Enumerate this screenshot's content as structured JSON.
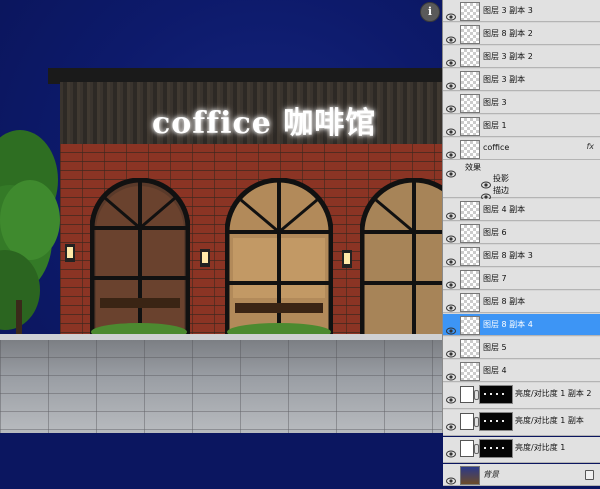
{
  "canvas": {
    "sign_text": "coffice 咖啡馆"
  },
  "panel": {
    "info_icon": "i",
    "layers": [
      {
        "name": "图层 3 副本 3",
        "thumb": "transparent"
      },
      {
        "name": "图层 8 副本 2",
        "thumb": "transparent"
      },
      {
        "name": "图层 3 副本 2",
        "thumb": "transparent"
      },
      {
        "name": "图层 3 副本",
        "thumb": "transparent"
      },
      {
        "name": "图层 3",
        "thumb": "transparent"
      },
      {
        "name": "图层 1",
        "thumb": "transparent"
      },
      {
        "name": "coffice",
        "thumb": "transparent",
        "fx": "fx"
      },
      {
        "name": "图层 4 副本",
        "thumb": "transparent"
      },
      {
        "name": "图层 6",
        "thumb": "transparent"
      },
      {
        "name": "图层 8 副本 3",
        "thumb": "transparent"
      },
      {
        "name": "图层 7",
        "thumb": "transparent"
      },
      {
        "name": "图层 8 副本",
        "thumb": "transparent"
      },
      {
        "name": "图层 8 副本 4",
        "thumb": "transparent",
        "selected": true
      },
      {
        "name": "图层 5",
        "thumb": "transparent"
      },
      {
        "name": "图层 4",
        "thumb": "transparent"
      }
    ],
    "effects": {
      "label": "效果",
      "items": [
        "投影",
        "描边"
      ]
    },
    "adjustments": [
      {
        "name": "亮度/对比度 1 副本 2"
      },
      {
        "name": "亮度/对比度 1 副本"
      },
      {
        "name": "亮度/对比度 1"
      }
    ],
    "background": {
      "name": "背景"
    }
  }
}
